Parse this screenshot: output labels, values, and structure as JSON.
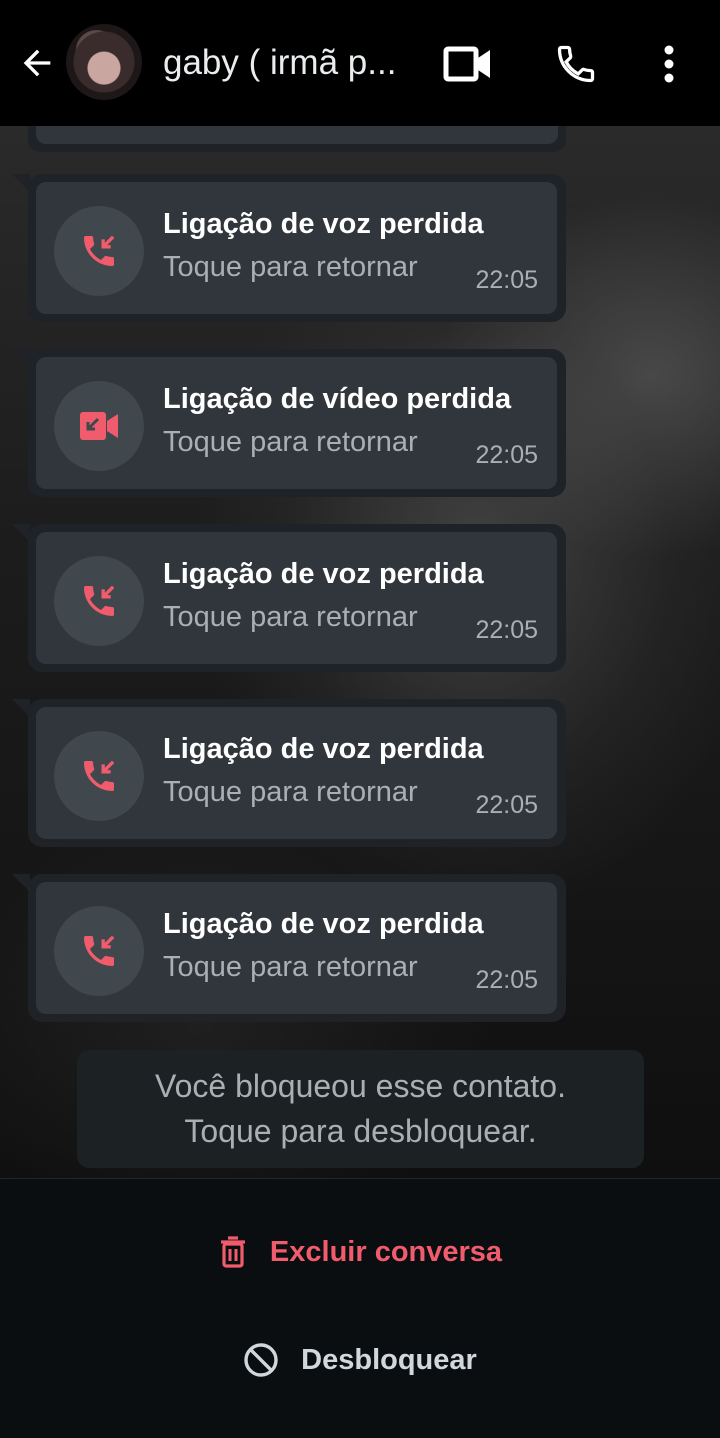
{
  "header": {
    "contact_name": "gaby ( irmã p...",
    "icons": {
      "back": "arrow-left-icon",
      "video": "video-camera-icon",
      "voice": "phone-icon",
      "menu": "more-vertical-icon"
    }
  },
  "messages": [
    {
      "title": "Ligação de voz perdida",
      "subtitle": "Toque para retornar",
      "time": "22:05",
      "kind": "voice"
    },
    {
      "title": "Ligação de vídeo perdida",
      "subtitle": "Toque para retornar",
      "time": "22:05",
      "kind": "video"
    },
    {
      "title": "Ligação de voz perdida",
      "subtitle": "Toque para retornar",
      "time": "22:05",
      "kind": "voice"
    },
    {
      "title": "Ligação de voz perdida",
      "subtitle": "Toque para retornar",
      "time": "22:05",
      "kind": "voice"
    },
    {
      "title": "Ligação de voz perdida",
      "subtitle": "Toque para retornar",
      "time": "22:05",
      "kind": "voice"
    }
  ],
  "blocked_notice": {
    "line1": "Você bloqueou esse contato.",
    "line2": "Toque para desbloquear."
  },
  "actions": {
    "delete_label": "Excluir conversa",
    "unblock_label": "Desbloquear"
  },
  "colors": {
    "missed_call_red": "#f15c6d",
    "bubble": "#30363b",
    "header_bg": "#000000"
  }
}
